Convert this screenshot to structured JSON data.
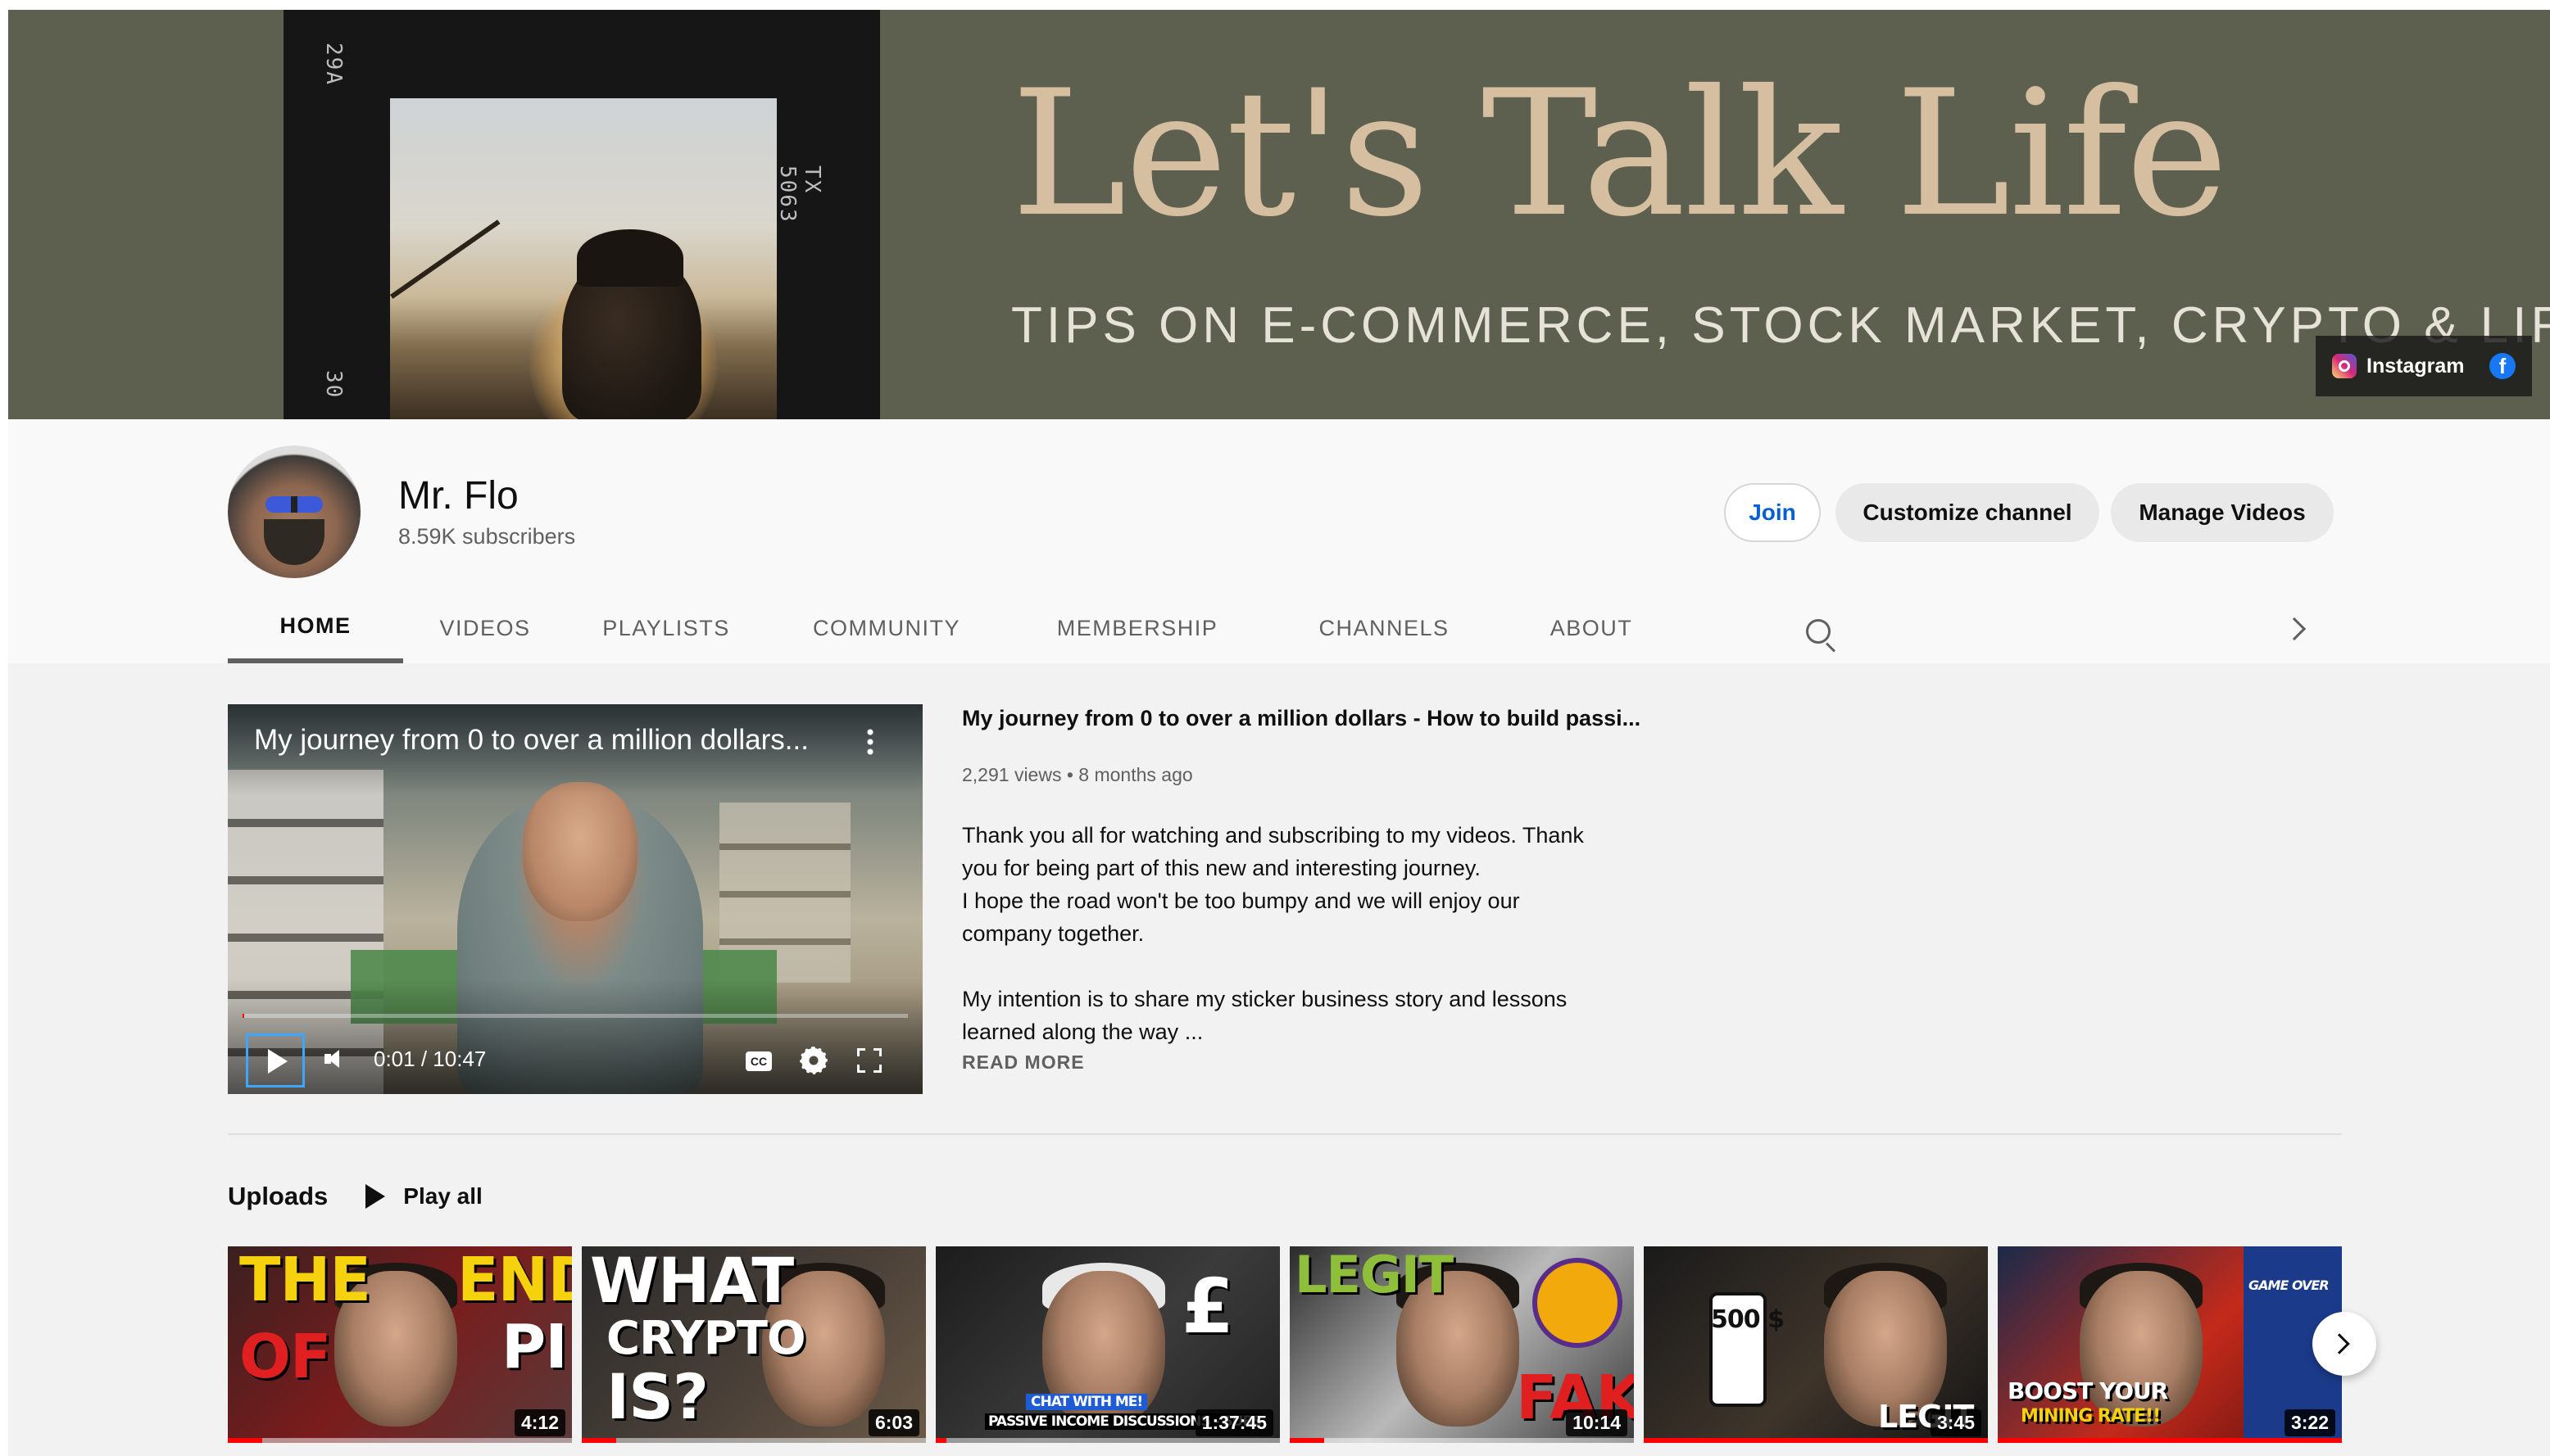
{
  "banner": {
    "title": "Let's Talk Life",
    "subtitle": "TIPS ON E-COMMERCE, STOCK MARKET, CRYPTO & LIFE",
    "film_labels": [
      "29A",
      "30",
      "TX 5063"
    ],
    "links": [
      {
        "label": "Instagram",
        "icon": "instagram-icon"
      },
      {
        "label": "",
        "icon": "facebook-icon"
      }
    ],
    "background_color": "#5d604f",
    "title_color": "#d6bea0"
  },
  "channel": {
    "name": "Mr. Flo",
    "subscribers": "8.59K subscribers",
    "buttons": {
      "join": "Join",
      "customize": "Customize channel",
      "manage": "Manage Videos"
    }
  },
  "tabs": [
    {
      "label": "HOME",
      "active": true
    },
    {
      "label": "VIDEOS",
      "active": false
    },
    {
      "label": "PLAYLISTS",
      "active": false
    },
    {
      "label": "COMMUNITY",
      "active": false
    },
    {
      "label": "MEMBERSHIP",
      "active": false
    },
    {
      "label": "CHANNELS",
      "active": false
    },
    {
      "label": "ABOUT",
      "active": false
    }
  ],
  "featured": {
    "player_title": "My journey from 0 to over a million dollars...",
    "time": "0:01 / 10:47",
    "cc": "CC",
    "progress_fraction": 0.002,
    "title": "My journey from 0 to over a million dollars - How to build passi...",
    "meta": "2,291 views • 8 months ago",
    "description": "Thank you all for watching and subscribing to my videos. Thank\nyou for being part of this new and interesting journey.\nI hope the road won't be too bumpy and we will enjoy our\ncompany together.\n\nMy intention is to share my sticker business story and lessons\nlearned along the way   ...",
    "read_more": "READ MORE"
  },
  "uploads": {
    "label": "Uploads",
    "play_all": "Play all",
    "videos": [
      {
        "duration": "4:12",
        "caption_lines": [
          "THE",
          "END",
          "OF",
          "PI"
        ],
        "watched_fraction": 0.1
      },
      {
        "duration": "6:03",
        "caption_lines": [
          "WHAT",
          "CRYPTO",
          "IS?"
        ],
        "watched_fraction": 0.1
      },
      {
        "duration": "1:37:45",
        "caption_lines": [
          "£",
          "CHAT WITH ME!",
          "PASSIVE INCOME DISCUSSIONS - SUBS"
        ],
        "watched_fraction": 0.03
      },
      {
        "duration": "10:14",
        "caption_lines": [
          "LEGIT",
          "FAKE"
        ],
        "watched_fraction": 0.1
      },
      {
        "duration": "3:45",
        "caption_lines": [
          "500 $",
          "LEGIT"
        ],
        "watched_fraction": 1.0
      },
      {
        "duration": "3:22",
        "caption_lines": [
          "BOOST YOUR",
          "MINING RATE!!",
          "GAME OVER"
        ],
        "watched_fraction": 1.0
      }
    ]
  },
  "colors": {
    "accent_red": "#ff0000",
    "join_blue": "#065fd4"
  }
}
